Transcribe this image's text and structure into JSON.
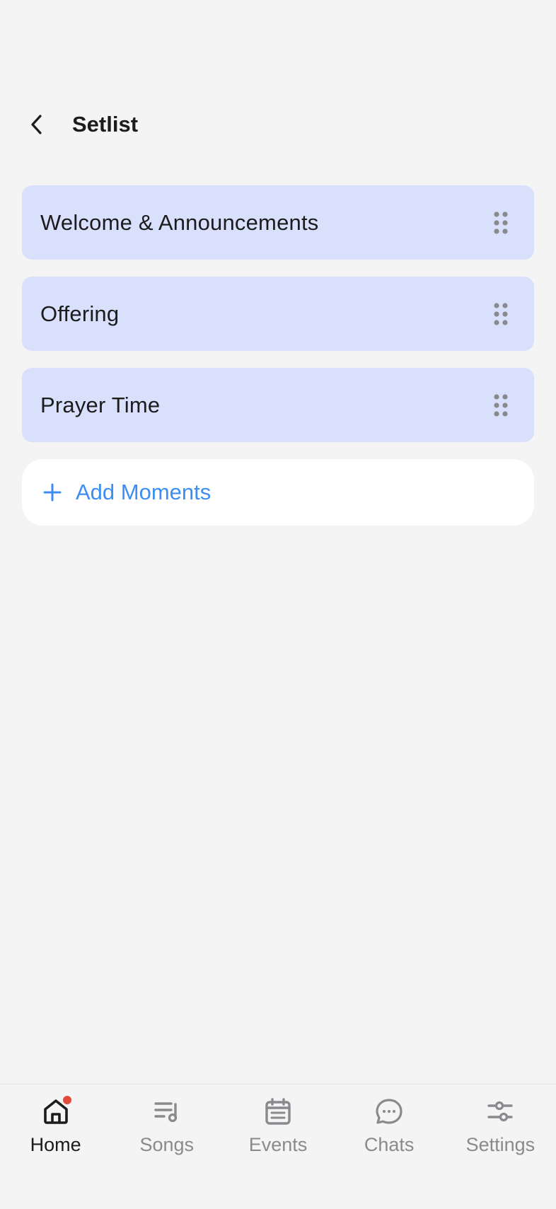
{
  "header": {
    "title": "Setlist",
    "back_icon": "chevron-left-icon"
  },
  "moments": [
    {
      "label": "Welcome & Announcements"
    },
    {
      "label": "Offering"
    },
    {
      "label": "Prayer Time"
    }
  ],
  "add_moments": {
    "label": "Add Moments",
    "icon": "plus-icon"
  },
  "nav": {
    "items": [
      {
        "label": "Home",
        "icon": "home-icon",
        "active": true,
        "notification": true
      },
      {
        "label": "Songs",
        "icon": "music-list-icon",
        "active": false
      },
      {
        "label": "Events",
        "icon": "calendar-icon",
        "active": false
      },
      {
        "label": "Chats",
        "icon": "chat-bubble-icon",
        "active": false
      },
      {
        "label": "Settings",
        "icon": "sliders-icon",
        "active": false
      }
    ]
  },
  "colors": {
    "background": "#f4f4f4",
    "moment_card": "#d9e0fb",
    "accent": "#3d8ef0",
    "notification": "#e24a3c",
    "inactive": "#8a8a8e"
  }
}
